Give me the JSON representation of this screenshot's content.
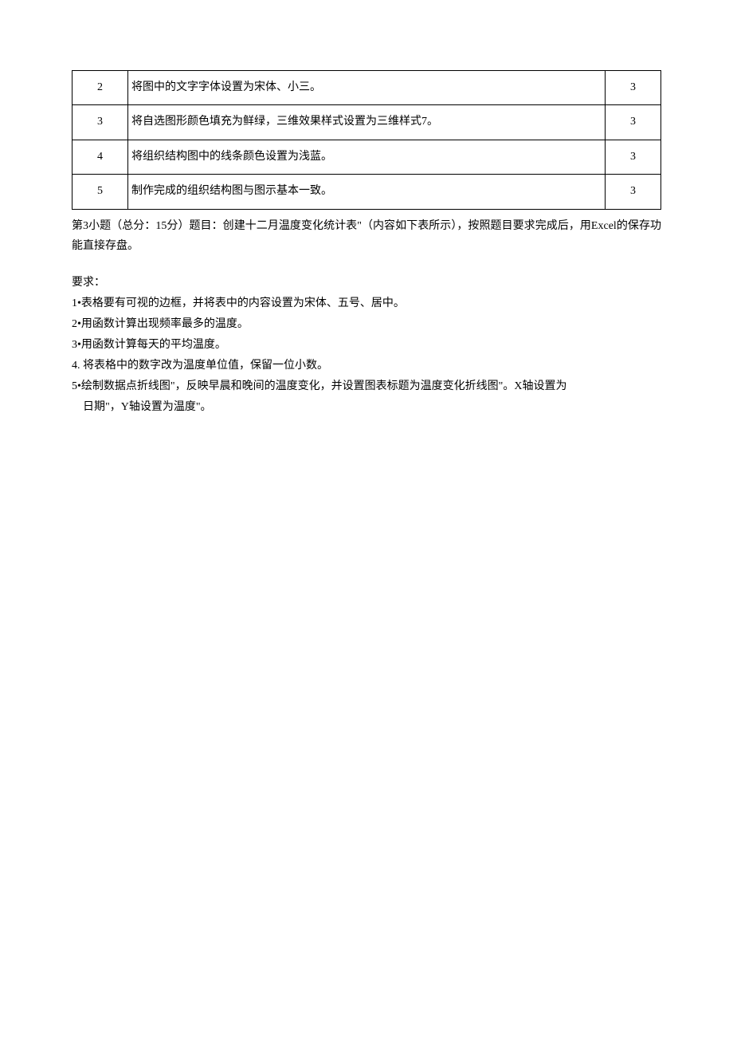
{
  "table": {
    "rows": [
      {
        "num": "2",
        "desc": "将图中的文字字体设置为宋体、小三。",
        "score": "3"
      },
      {
        "num": "3",
        "desc": "将自选图形颜色填充为鲜绿，三维效果样式设置为三维样式7。",
        "score": "3"
      },
      {
        "num": "4",
        "desc": "将组织结构图中的线条颜色设置为浅蓝。",
        "score": "3"
      },
      {
        "num": "5",
        "desc": "制作完成的组织结构图与图示基本一致。",
        "score": "3"
      }
    ]
  },
  "question": {
    "intro": "第3小题（总分：15分）题目：创建十二月温度变化统计表\"（内容如下表所示），按照题目要求完成后，用Excel的保存功能直接存盘。"
  },
  "requirements": {
    "heading": "要求：",
    "items": [
      "1•表格要有可视的边框，并将表中的内容设置为宋体、五号、居中。",
      "2•用函数计算出现频率最多的温度。",
      "3•用函数计算每天的平均温度。",
      "4. 将表格中的数字改为温度单位值，保留一位小数。",
      "5•绘制数据点折线图\"，反映早晨和晚间的温度变化，并设置图表标题为温度变化折线图\"。X轴设置为",
      "日期\"，Y轴设置为温度\"。"
    ]
  }
}
